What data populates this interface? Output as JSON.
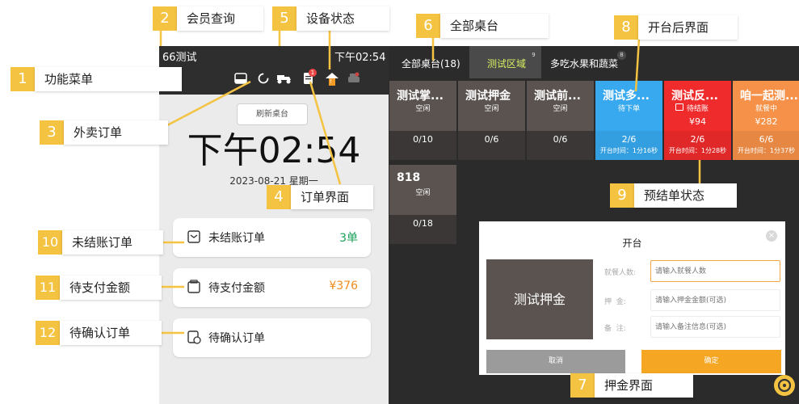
{
  "pos": {
    "store_name": "66测试",
    "time_small": "下午02:54",
    "refresh_button": "刷新桌台",
    "big_clock": "下午02:54",
    "date": "2023-08-21 星期一",
    "order_badge": "1",
    "device_badge": "!",
    "cards": [
      {
        "label": "未结账订单",
        "value": "3单",
        "value_color": "#1aa15a"
      },
      {
        "label": "待支付金额",
        "value": "¥376",
        "value_color": "#f08c1e"
      },
      {
        "label": "待确认订单",
        "value": "",
        "value_color": "#222222"
      }
    ],
    "tabs": [
      {
        "label": "全部桌台(18)",
        "badge": ""
      },
      {
        "label": "测试区域",
        "badge": "9"
      },
      {
        "label": "多吃水果和蔬菜",
        "badge": "8"
      }
    ],
    "tables": [
      {
        "name": "测试掌...",
        "status": "空闲",
        "amount": "",
        "seats": "0/10",
        "time": "",
        "color": "#5a5350"
      },
      {
        "name": "测试押金",
        "status": "空闲",
        "amount": "",
        "seats": "0/6",
        "time": "",
        "color": "#5a5350"
      },
      {
        "name": "测试前...",
        "status": "空闲",
        "amount": "",
        "seats": "0/6",
        "time": "",
        "color": "#5a5350"
      },
      {
        "name": "测试多...",
        "status": "待下单",
        "amount": "",
        "seats": "2/6",
        "time": "开台时间：1分16秒",
        "color": "#38a9ee"
      },
      {
        "name": "测试反...",
        "status": "待结账",
        "amount": "¥94",
        "seats": "2/6",
        "time": "开台时间：1分28秒",
        "color": "#f02b2b"
      },
      {
        "name": "咱一起测...",
        "status": "就餐中",
        "amount": "¥282",
        "seats": "6/6",
        "time": "开台时间：1分37秒",
        "color": "#f59148"
      },
      {
        "name": "818",
        "status": "空闲",
        "amount": "",
        "seats": "0/18",
        "time": "",
        "color": "#5a5350"
      }
    ],
    "dialog": {
      "title": "开台",
      "table_name": "测试押金",
      "fields": [
        {
          "label": "就餐人数:",
          "placeholder": "请输入就餐人数"
        },
        {
          "label": "押  金:",
          "placeholder": "请输入押金金额(可选)"
        },
        {
          "label": "备  注:",
          "placeholder": "请输入备注信息(可选)"
        }
      ],
      "cancel": "取消",
      "confirm": "确定"
    }
  },
  "annotations": [
    {
      "num": "1",
      "label": "功能菜单"
    },
    {
      "num": "2",
      "label": "会员查询"
    },
    {
      "num": "3",
      "label": "外卖订单"
    },
    {
      "num": "4",
      "label": "订单界面"
    },
    {
      "num": "5",
      "label": "设备状态"
    },
    {
      "num": "6",
      "label": "全部桌台"
    },
    {
      "num": "7",
      "label": "押金界面"
    },
    {
      "num": "8",
      "label": "开台后界面"
    },
    {
      "num": "9",
      "label": "预结单状态"
    },
    {
      "num": "10",
      "label": "未结账订单"
    },
    {
      "num": "11",
      "label": "待支付金额"
    },
    {
      "num": "12",
      "label": "待确认订单"
    }
  ],
  "colors": {
    "accent": "#f5c342",
    "active_tab": "#d6f062",
    "dialog_confirm": "#f5a623"
  }
}
